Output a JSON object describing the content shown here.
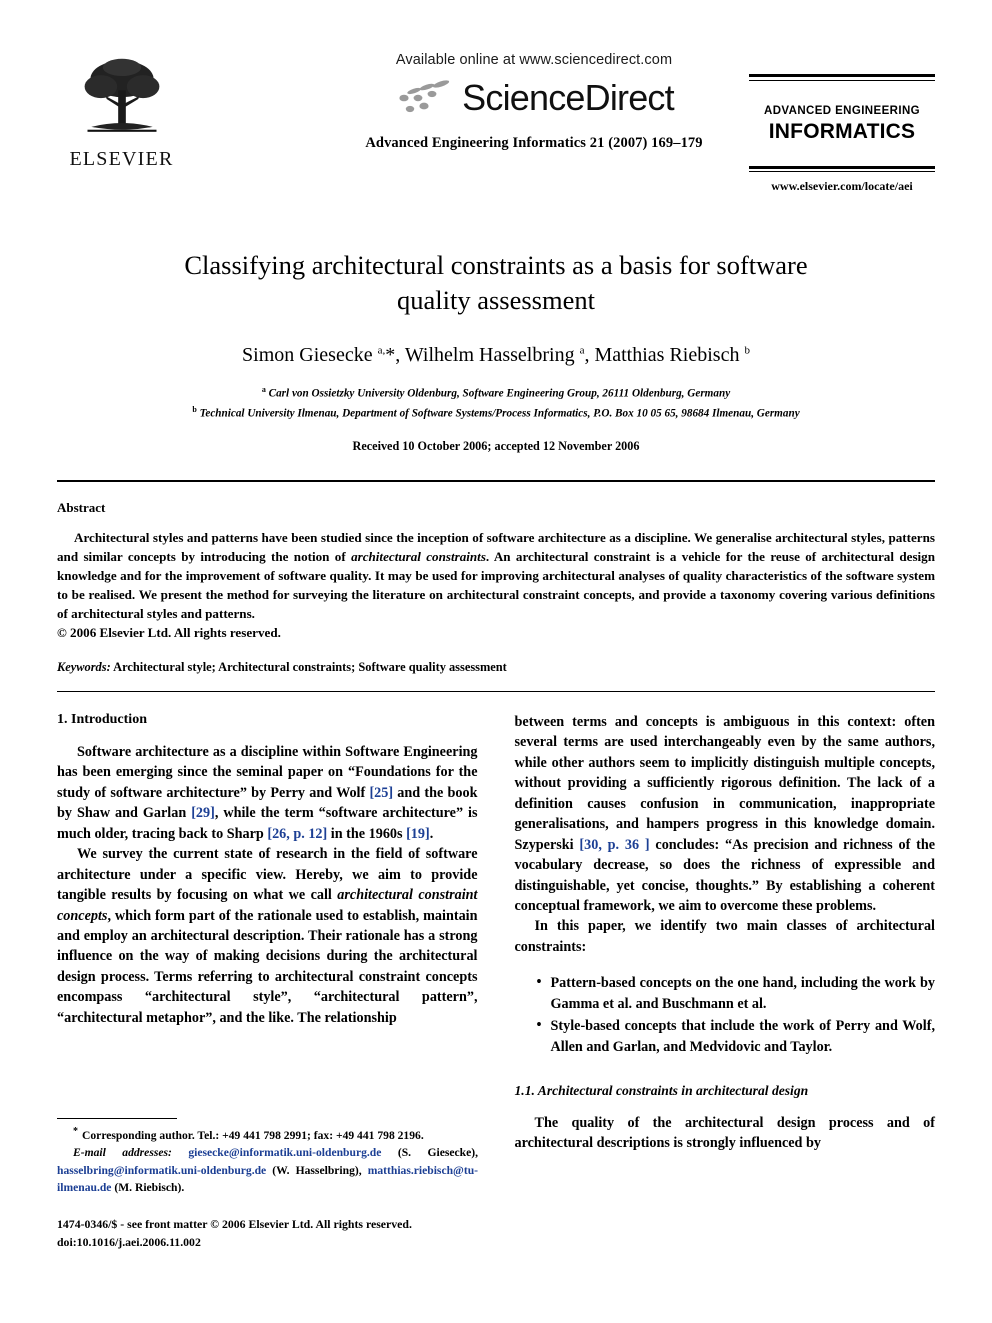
{
  "masthead": {
    "publisher_name": "ELSEVIER",
    "available_online": "Available online at www.sciencedirect.com",
    "sciencedirect_wordmark": "ScienceDirect",
    "journal_reference": "Advanced Engineering Informatics 21 (2007) 169–179",
    "journal_badge_line1": "ADVANCED ENGINEERING",
    "journal_badge_line2": "INFORMATICS",
    "journal_url": "www.elsevier.com/locate/aei"
  },
  "article": {
    "title": "Classifying architectural constraints as a basis for software quality assessment",
    "authors_html": "Simon Giesecke <sup>a,</sup>*, Wilhelm Hasselbring <sup>a</sup>, Matthias Riebisch <sup>b</sup>",
    "authors_plain": "Simon Giesecke a,*, Wilhelm Hasselbring a, Matthias Riebisch b",
    "affiliation_a": "Carl von Ossietzky University Oldenburg, Software Engineering Group, 26111 Oldenburg, Germany",
    "affiliation_b": "Technical University Ilmenau, Department of Software Systems/Process Informatics, P.O. Box 10 05 65, 98684 Ilmenau, Germany",
    "history": "Received 10 October 2006; accepted 12 November 2006"
  },
  "abstract": {
    "heading": "Abstract",
    "part1": "Architectural styles and patterns have been studied since the inception of software architecture as a discipline. We generalise architectural styles, patterns and similar concepts by introducing the notion of ",
    "emphasis": "architectural constraints",
    "part2": ". An architectural constraint is a vehicle for the reuse of architectural design knowledge and for the improvement of software quality. It may be used for improving architectural analyses of quality characteristics of the software system to be realised. We present the method for surveying the literature on architectural constraint concepts, and provide a taxonomy covering various definitions of architectural styles and patterns.",
    "copyright": "© 2006 Elsevier Ltd. All rights reserved.",
    "keywords_label": "Keywords:",
    "keywords_value": "Architectural style; Architectural constraints; Software quality assessment"
  },
  "body": {
    "section1_heading": "1. Introduction",
    "left_para1_a": "Software architecture as a discipline within Software Engineering has been emerging since the seminal paper on “Foundations for the study of software architecture” by Perry and Wolf ",
    "cite_25": "[25]",
    "left_para1_b": " and the book by Shaw and Garlan ",
    "cite_29": "[29]",
    "left_para1_c": ", while the term “software architecture” is much older, tracing back to Sharp ",
    "cite_26": "[26, p. 12]",
    "left_para1_d": " in the 1960s ",
    "cite_19": "[19]",
    "left_para1_e": ".",
    "left_para2_a": "We survey the current state of research in the field of software architecture under a specific view. Hereby, we aim to provide tangible results by focusing on what we call ",
    "left_para2_em": "architectural constraint concepts",
    "left_para2_b": ", which form part of the rationale used to establish, maintain and employ an architectural description. Their rationale has a strong influence on the way of making decisions during the architectural design process. Terms referring to architectural constraint concepts encompass “architectural style”, “architectural pattern”, “architectural metaphor”, and the like. The relationship",
    "right_para1_a": "between terms and concepts is ambiguous in this context: often several terms are used interchangeably even by the same authors, while other authors seem to implicitly distinguish multiple concepts, without providing a sufficiently rigorous definition. The lack of a definition causes confusion in communication, inappropriate generalisations, and hampers progress in this knowledge domain. Szyperski ",
    "cite_30": "[30, p. 36 ]",
    "right_para1_b": " concludes: “As precision and richness of the vocabulary decrease, so does the richness of expressible and distinguishable, yet concise, thoughts.” By establishing a coherent conceptual framework, we aim to overcome these problems.",
    "right_para2": "In this paper, we identify two main classes of architectural constraints:",
    "bullet1": "Pattern-based concepts on the one hand, including the work by Gamma et al. and Buschmann et al.",
    "bullet2": "Style-based concepts that include the work of Perry and Wolf, Allen and Garlan, and Medvidovic and Taylor.",
    "subsection_heading": "1.1. Architectural constraints in architectural design",
    "right_para3": "The quality of the architectural design process and of architectural descriptions is strongly influenced by"
  },
  "footnotes": {
    "corresponding_marker": "*",
    "corresponding_text": "Corresponding author. Tel.: +49 441 798 2991; fax: +49 441 798 2196.",
    "email_label": "E-mail addresses:",
    "email1": "giesecke@informatik.uni-oldenburg.de",
    "email1_owner": "(S. Giesecke),",
    "email2": "hasselbring@informatik.uni-oldenburg.de",
    "email2_owner": "(W. Hasselbring),",
    "email3": "matthias.riebisch@tu-ilmenau.de",
    "email3_owner": "(M. Riebisch)."
  },
  "imprint": {
    "issn_line": "1474-0346/$ - see front matter © 2006 Elsevier Ltd. All rights reserved.",
    "doi_line": "doi:10.1016/j.aei.2006.11.002"
  },
  "colors": {
    "link": "#1c3f94",
    "text": "#000000",
    "background": "#ffffff"
  }
}
